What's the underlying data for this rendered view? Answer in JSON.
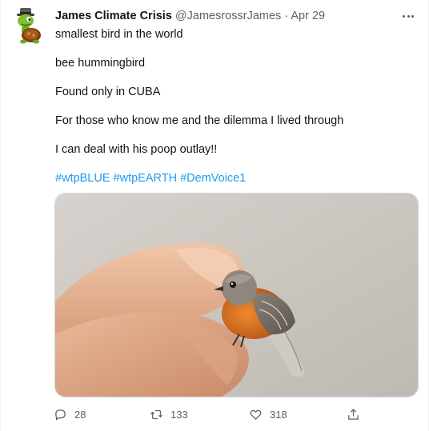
{
  "tweet": {
    "author_name": "James Climate Crisis",
    "handle": "@JamesrossrJames",
    "separator": "·",
    "date": "Apr 29",
    "lines": [
      "smallest bird in the world",
      "bee hummingbird",
      "Found only in CUBA",
      "For those who know me and the dilemma I lived through",
      "I can deal with his poop outlay!!"
    ],
    "hashtags": [
      "#wtpBLUE",
      "#wtpEARTH",
      "#DemVoice1"
    ]
  },
  "actions": {
    "replies": "28",
    "retweets": "133",
    "likes": "318"
  },
  "icons": {
    "more": "more-horizontal-icon",
    "reply": "reply-icon",
    "retweet": "retweet-icon",
    "like": "heart-icon",
    "share": "share-icon"
  },
  "colors": {
    "link": "#1d9bf0",
    "secondary": "#536471",
    "text": "#0f1419"
  }
}
